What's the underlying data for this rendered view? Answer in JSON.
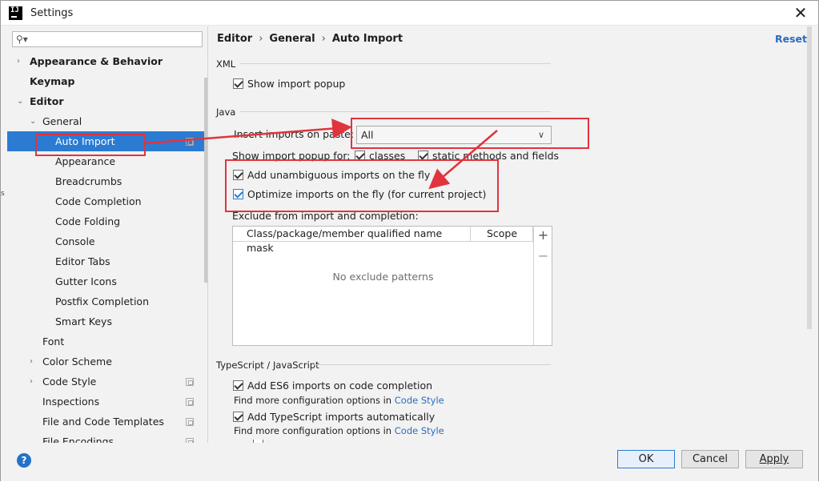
{
  "window": {
    "title": "Settings",
    "app_icon_text": "IJ",
    "close_icon": "close-icon"
  },
  "sidebar": {
    "search_placeholder": "",
    "tree": [
      {
        "label": "Appearance & Behavior",
        "arrow": "›",
        "bold": true,
        "config": false
      },
      {
        "label": "Keymap",
        "arrow": "",
        "bold": true,
        "config": false
      },
      {
        "label": "Editor",
        "arrow": "⌄",
        "bold": true,
        "config": false
      },
      {
        "label": "General",
        "arrow": "⌄",
        "bold": false,
        "config": false
      },
      {
        "label": "Auto Import",
        "arrow": "",
        "bold": false,
        "config": true,
        "selected": true
      },
      {
        "label": "Appearance",
        "arrow": "",
        "bold": false,
        "config": false
      },
      {
        "label": "Breadcrumbs",
        "arrow": "",
        "bold": false,
        "config": false
      },
      {
        "label": "Code Completion",
        "arrow": "",
        "bold": false,
        "config": false
      },
      {
        "label": "Code Folding",
        "arrow": "",
        "bold": false,
        "config": false
      },
      {
        "label": "Console",
        "arrow": "",
        "bold": false,
        "config": false
      },
      {
        "label": "Editor Tabs",
        "arrow": "",
        "bold": false,
        "config": false
      },
      {
        "label": "Gutter Icons",
        "arrow": "",
        "bold": false,
        "config": false
      },
      {
        "label": "Postfix Completion",
        "arrow": "",
        "bold": false,
        "config": false
      },
      {
        "label": "Smart Keys",
        "arrow": "",
        "bold": false,
        "config": false
      },
      {
        "label": "Font",
        "arrow": "",
        "bold": false,
        "config": false
      },
      {
        "label": "Color Scheme",
        "arrow": "›",
        "bold": false,
        "config": false
      },
      {
        "label": "Code Style",
        "arrow": "›",
        "bold": false,
        "config": true
      },
      {
        "label": "Inspections",
        "arrow": "",
        "bold": false,
        "config": true
      },
      {
        "label": "File and Code Templates",
        "arrow": "",
        "bold": false,
        "config": true
      },
      {
        "label": "File Encodings",
        "arrow": "",
        "bold": false,
        "config": true
      }
    ]
  },
  "breadcrumb": [
    "Editor",
    "General",
    "Auto Import"
  ],
  "breadcrumb_sep": "›",
  "reset_label": "Reset",
  "xml": {
    "section": "XML",
    "show_popup": {
      "label": "Show import popup",
      "checked": true
    }
  },
  "java": {
    "section": "Java",
    "insert_label": "Insert imports on paste:",
    "insert_value": "All",
    "show_popup_for_label": "Show import popup for:",
    "classes": {
      "label": "classes",
      "checked": true
    },
    "static": {
      "label": "static methods and fields",
      "checked": true
    },
    "add_unambiguous": {
      "label": "Add unambiguous imports on the fly",
      "checked": true
    },
    "optimize": {
      "label": "Optimize imports on the fly (for current project)",
      "checked": true
    },
    "exclude_label": "Exclude from import and completion:",
    "table": {
      "col1": "Class/package/member qualified name mask",
      "col2": "Scope",
      "empty": "No exclude patterns"
    }
  },
  "ts": {
    "section": "TypeScript / JavaScript",
    "add_es6": {
      "label": "Add ES6 imports on code completion",
      "checked": true
    },
    "more1": "Find more configuration options in",
    "link1": "Code Style",
    "add_ts": {
      "label": "Add TypeScript imports automatically",
      "checked": true
    },
    "more2": "Find more configuration options in",
    "link2": "Code Style"
  },
  "buttons": {
    "ok": "OK",
    "cancel": "Cancel",
    "apply": "Apply",
    "help": "?"
  },
  "colors": {
    "accent": "#2b7bd3",
    "annotation": "#e0343e",
    "link": "#2a6cc0"
  }
}
